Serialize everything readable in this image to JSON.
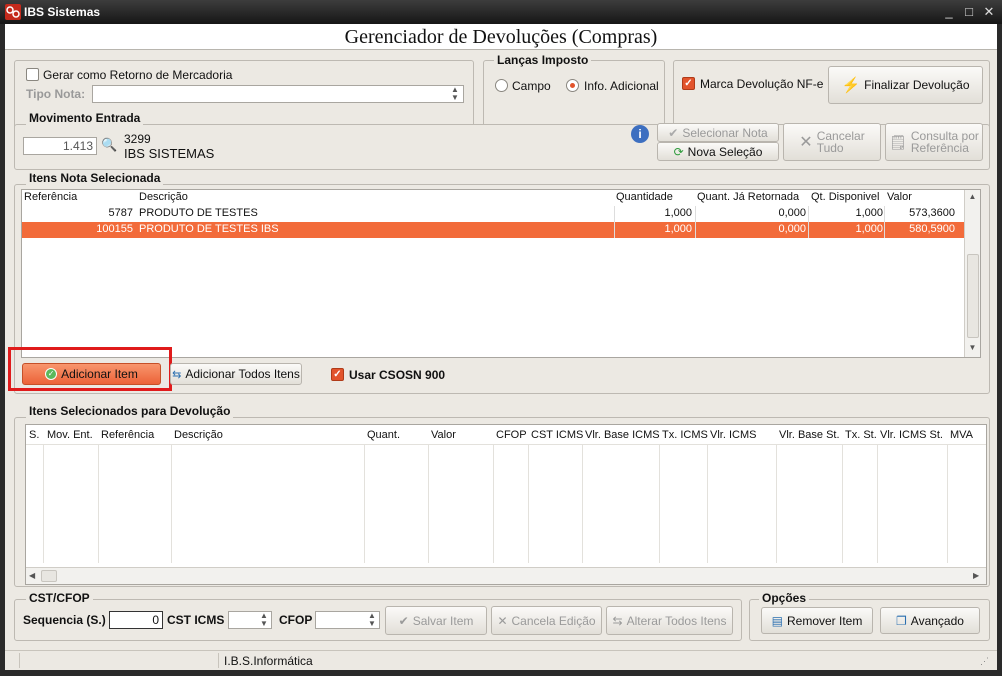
{
  "window": {
    "title": "IBS Sistemas",
    "min": "_",
    "max": "□",
    "close": "✕"
  },
  "header": {
    "title": "Gerenciador de Devoluções (Compras)"
  },
  "top": {
    "gerar_retorno_label": "Gerar como Retorno de Mercadoria",
    "tipo_nota_label": "Tipo Nota:",
    "tipo_nota_value": ""
  },
  "lanca_imposto": {
    "title": "Lanças Imposto",
    "campo": "Campo",
    "info": "Info. Adicional"
  },
  "marca": {
    "label": "Marca Devolução NF-e",
    "finalizar": "Finalizar Devolução"
  },
  "movimento": {
    "title": "Movimento Entrada",
    "value": "1.413",
    "code": "3299",
    "name": "IBS SISTEMAS",
    "selecionar_nota": "Selecionar Nota",
    "nova_selecao": "Nova Seleção",
    "cancelar_tudo_1": "Cancelar",
    "cancelar_tudo_2": "Tudo",
    "consulta_1": "Consulta por",
    "consulta_2": "Referência"
  },
  "itens_nota": {
    "title": "Itens Nota Selecionada",
    "headers": [
      "Referência",
      "Descrição",
      "Quantidade",
      "Quant. Já Retornada",
      "Qt. Disponivel",
      "Valor"
    ],
    "rows": [
      [
        "5787",
        "PRODUTO DE TESTES",
        "1,000",
        "0,000",
        "1,000",
        "573,3600"
      ],
      [
        "100155",
        "PRODUTO DE TESTES IBS",
        "1,000",
        "0,000",
        "1,000",
        "580,5900"
      ]
    ],
    "adicionar_item": "Adicionar Item",
    "adicionar_todos": "Adicionar Todos Itens",
    "usar_csosn": "Usar CSOSN 900",
    "highlight_color": "#f26b3a"
  },
  "devolucao": {
    "title": "Itens Selecionados para Devolução",
    "headers": [
      "S.",
      "Mov. Ent.",
      "Referência",
      "Descrição",
      "Quant.",
      "Valor",
      "CFOP",
      "CST ICMS",
      "Vlr. Base ICMS",
      "Tx. ICMS",
      "Vlr. ICMS",
      "Vlr. Base St.",
      "Tx. St.",
      "Vlr. ICMS St.",
      "MVA"
    ]
  },
  "cst": {
    "title": "CST/CFOP",
    "sequencia_label": "Sequencia (S.)",
    "sequencia_value": "0",
    "cst_icms_label": "CST ICMS",
    "cfop_label": "CFOP",
    "salvar": "Salvar Item",
    "cancela": "Cancela Edição",
    "alterar": "Alterar Todos Itens"
  },
  "opcoes": {
    "title": "Opções",
    "remover": "Remover Item",
    "avancado": "Avançado"
  },
  "status": {
    "text": "I.B.S.Informática"
  }
}
